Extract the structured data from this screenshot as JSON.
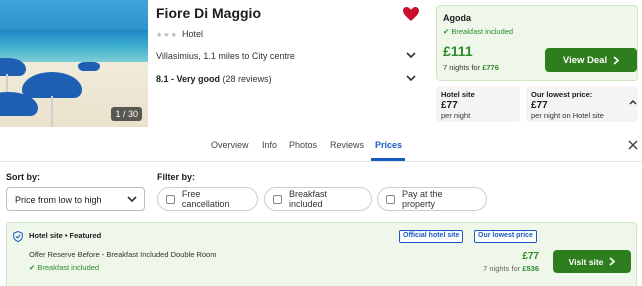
{
  "hotel": {
    "name": "Fiore Di Maggio",
    "type": "Hotel",
    "star_rating": 3,
    "address": "Villasimius, 1.1 miles to City centre",
    "rating_score": "8.1 - Very good",
    "rating_reviews": "(28 reviews)",
    "photo_counter": "1 / 30"
  },
  "deal": {
    "provider": "Agoda",
    "breakfast": "Breakfast included",
    "price": "£111",
    "nights_prefix": "7 nights for",
    "nights_total": "£776",
    "button": "View Deal"
  },
  "hotel_site": {
    "heading": "Hotel site",
    "price": "£77",
    "sub": "per night"
  },
  "lowest": {
    "heading": "Our lowest price:",
    "price": "£77",
    "sub": "per night on Hotel site"
  },
  "tabs": [
    {
      "label": "Overview"
    },
    {
      "label": "Info"
    },
    {
      "label": "Photos"
    },
    {
      "label": "Reviews"
    },
    {
      "label": "Prices",
      "active": true
    }
  ],
  "sort": {
    "label": "Sort by:",
    "value": "Price from low to high"
  },
  "filter": {
    "label": "Filter by:",
    "options": [
      "Free cancellation",
      "Breakfast included",
      "Pay at the property"
    ]
  },
  "featured": {
    "heading": "Hotel site • Featured",
    "badges": [
      "Official hotel site",
      "Our lowest price"
    ],
    "room": "Offer Reserve Before - Breakfast Included Double Room",
    "breakfast": "Breakfast included",
    "price": "£77",
    "nights_prefix": "7 nights for",
    "nights_total": "£536",
    "button": "Visit site"
  },
  "colors": {
    "accent_green": "#2e7d1f",
    "accent_blue": "#1a5ac4",
    "heart": "#c8102e"
  }
}
